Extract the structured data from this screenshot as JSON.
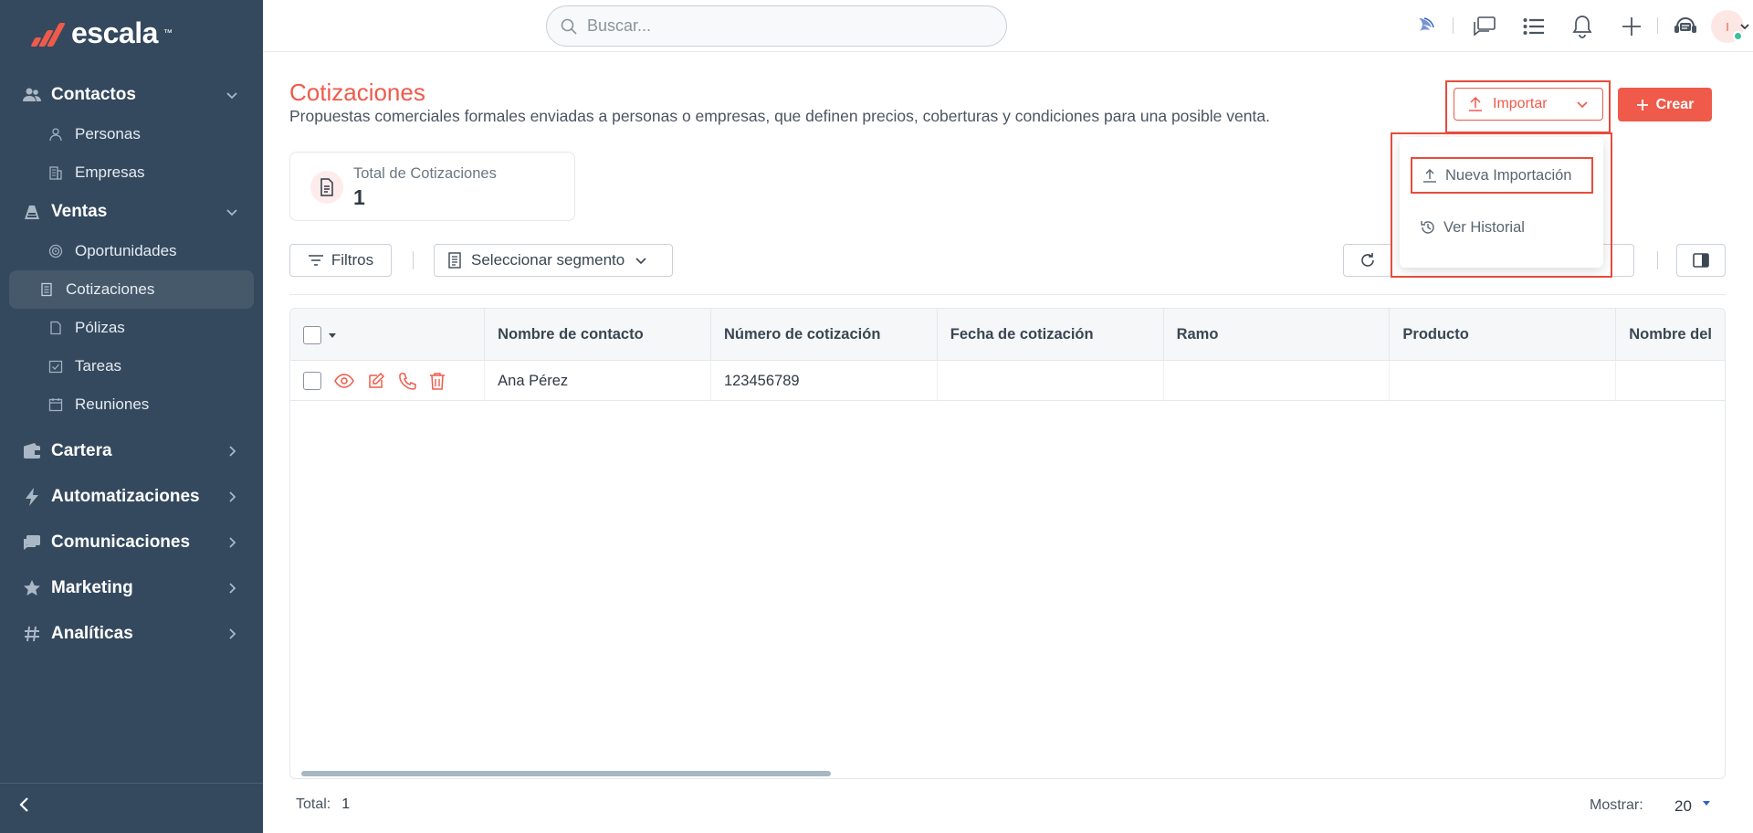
{
  "brand": {
    "name": "escala",
    "tm": "™",
    "accent": "#f05a4a",
    "sidebar_bg": "#34495e"
  },
  "search": {
    "placeholder": "Buscar..."
  },
  "topbar": {
    "icons": [
      "logo-bird-icon",
      "chat-icon",
      "list-icon",
      "bell-icon",
      "plus-icon",
      "support-icon"
    ],
    "avatar_initial": "I"
  },
  "sidebar": {
    "sections": [
      {
        "label": "Contactos",
        "expanded": true,
        "items": [
          "Personas",
          "Empresas"
        ]
      },
      {
        "label": "Ventas",
        "expanded": true,
        "items": [
          "Oportunidades",
          "Cotizaciones",
          "Pólizas",
          "Tareas",
          "Reuniones"
        ]
      },
      {
        "label": "Cartera",
        "expanded": false
      },
      {
        "label": "Automatizaciones",
        "expanded": false
      },
      {
        "label": "Comunicaciones",
        "expanded": false
      },
      {
        "label": "Marketing",
        "expanded": false
      },
      {
        "label": "Analíticas",
        "expanded": false
      }
    ],
    "active_item": "Cotizaciones"
  },
  "header": {
    "title": "Cotizaciones",
    "description": "Propuestas comerciales formales enviadas a personas o empresas, que definen precios, coberturas y condiciones para una posible venta.",
    "import_label": "Importar",
    "create_label": "Crear"
  },
  "import_menu": {
    "items": [
      "Nueva Importación",
      "Ver Historial"
    ]
  },
  "stats": {
    "label": "Total de Cotizaciones",
    "value": "1"
  },
  "toolbar": {
    "filters_label": "Filtros",
    "segment_label": "Seleccionar segmento"
  },
  "table": {
    "columns": [
      "Nombre de contacto",
      "Número de cotización",
      "Fecha de cotización",
      "Ramo",
      "Producto",
      "Nombre del"
    ],
    "rows": [
      {
        "contact": "Ana Pérez",
        "number": "123456789",
        "date": "",
        "ramo": "",
        "product": "",
        "name": ""
      }
    ]
  },
  "footer": {
    "total_label": "Total:",
    "total_value": "1",
    "show_label": "Mostrar:",
    "show_value": "20"
  }
}
